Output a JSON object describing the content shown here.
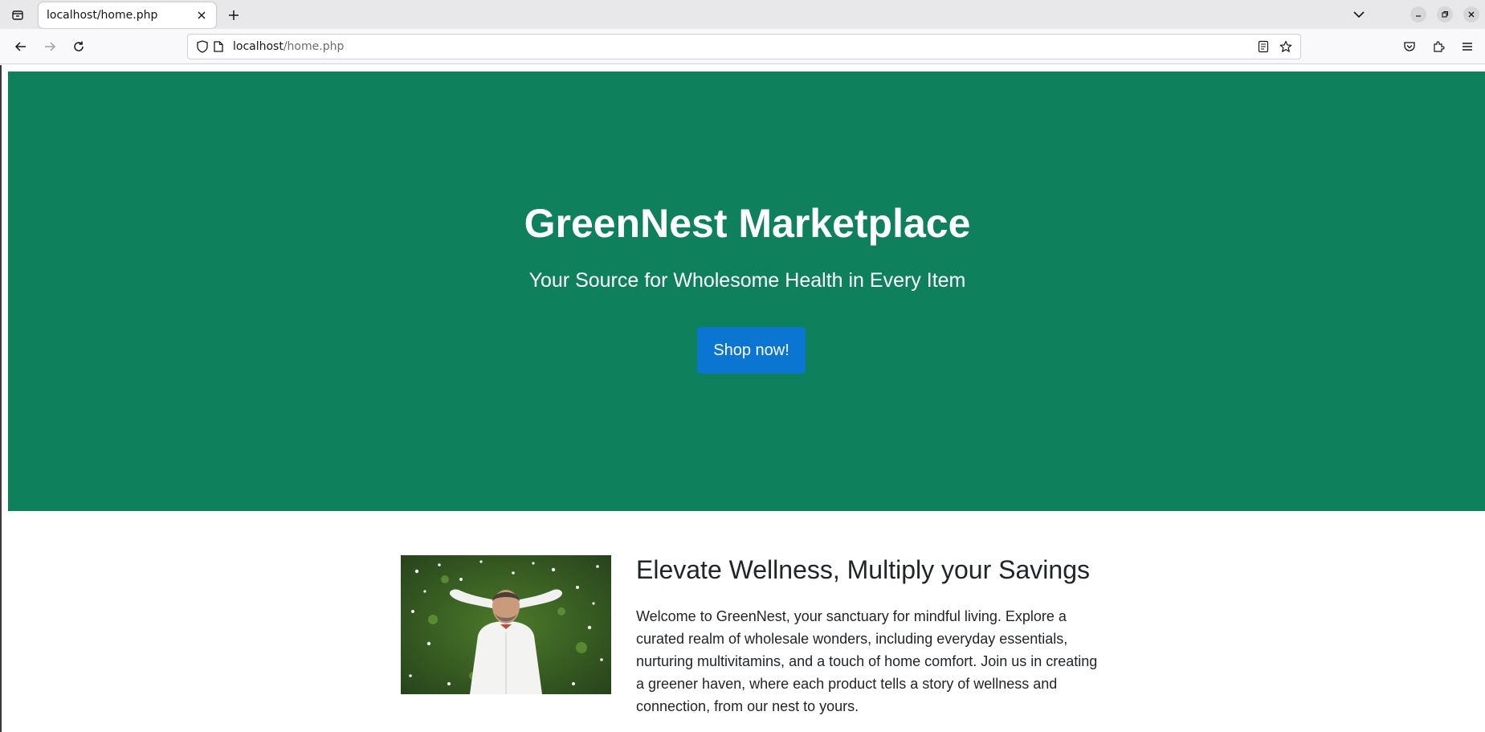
{
  "browser": {
    "tab": {
      "title": "localhost/home.php"
    },
    "url": {
      "host": "localhost",
      "path": "/home.php"
    }
  },
  "hero": {
    "title": "GreenNest Marketplace",
    "subtitle": "Your Source for Wholesome Health in Every Item",
    "cta_label": "Shop now!",
    "background_color": "#0e805c",
    "button_color": "#0a76d1"
  },
  "about": {
    "heading": "Elevate Wellness, Multiply your Savings",
    "body": "Welcome to GreenNest, your sanctuary for mindful living. Explore a curated realm of wholesale wonders, including everyday essentials, nurturing multivitamins, and a touch of home comfort. Join us in creating a greener haven, where each product tells a story of wellness and connection, from our nest to yours."
  },
  "icons": {
    "tab_list": "tab-list-icon",
    "close_tab": "close-icon",
    "new_tab": "plus-icon",
    "list_all_tabs": "chevron-down-icon",
    "minimize": "minimize-icon",
    "restore": "restore-icon",
    "close_window": "close-window-icon",
    "back": "back-arrow-icon",
    "forward": "forward-arrow-icon",
    "reload": "reload-icon",
    "shield": "shield-icon",
    "page": "page-icon",
    "reader": "reader-view-icon",
    "bookmark": "star-icon",
    "pocket": "pocket-icon",
    "extensions": "extensions-icon",
    "menu": "hamburger-menu-icon"
  }
}
